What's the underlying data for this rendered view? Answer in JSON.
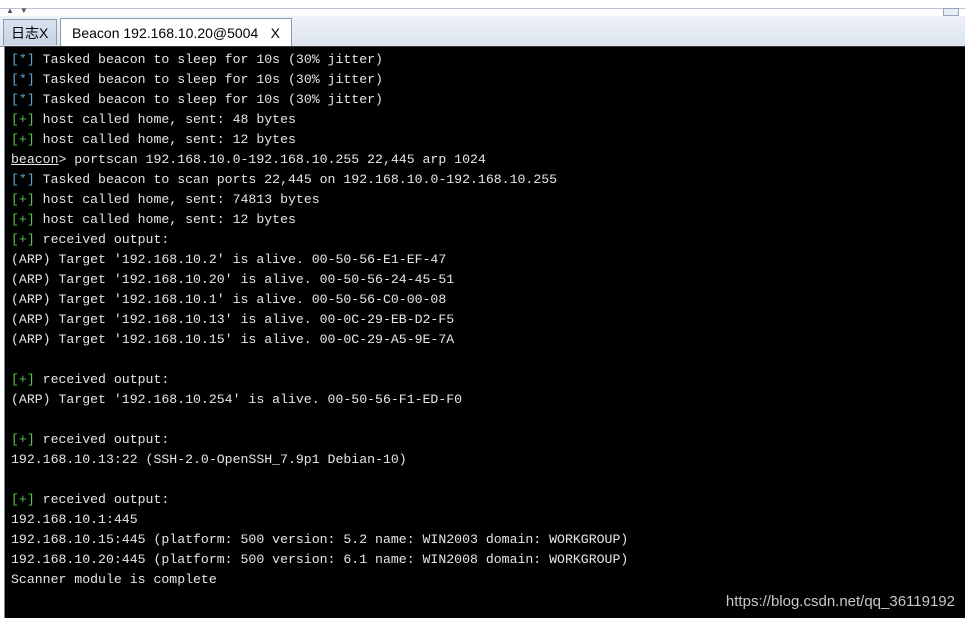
{
  "tabs": [
    {
      "label": "日志",
      "close": "X"
    },
    {
      "label": "Beacon 192.168.10.20@5004",
      "close": "X"
    }
  ],
  "console": {
    "lines": [
      {
        "tag": "[*]",
        "type": "info",
        "text": " Tasked beacon to sleep for 10s (30% jitter)"
      },
      {
        "tag": "[*]",
        "type": "info",
        "text": " Tasked beacon to sleep for 10s (30% jitter)"
      },
      {
        "tag": "[*]",
        "type": "info",
        "text": " Tasked beacon to sleep for 10s (30% jitter)"
      },
      {
        "tag": "[+]",
        "type": "good",
        "text": " host called home, sent: 48 bytes"
      },
      {
        "tag": "[+]",
        "type": "good",
        "text": " host called home, sent: 12 bytes"
      },
      {
        "prompt": "beacon",
        "type": "prompt",
        "text": "> portscan 192.168.10.0-192.168.10.255 22,445 arp 1024"
      },
      {
        "tag": "[*]",
        "type": "info",
        "text": " Tasked beacon to scan ports 22,445 on 192.168.10.0-192.168.10.255"
      },
      {
        "tag": "[+]",
        "type": "good",
        "text": " host called home, sent: 74813 bytes"
      },
      {
        "tag": "[+]",
        "type": "good",
        "text": " host called home, sent: 12 bytes"
      },
      {
        "tag": "[+]",
        "type": "good",
        "text": " received output:"
      },
      {
        "type": "plain",
        "text": "(ARP) Target '192.168.10.2' is alive. 00-50-56-E1-EF-47"
      },
      {
        "type": "plain",
        "text": "(ARP) Target '192.168.10.20' is alive. 00-50-56-24-45-51"
      },
      {
        "type": "plain",
        "text": "(ARP) Target '192.168.10.1' is alive. 00-50-56-C0-00-08"
      },
      {
        "type": "plain",
        "text": "(ARP) Target '192.168.10.13' is alive. 00-0C-29-EB-D2-F5"
      },
      {
        "type": "plain",
        "text": "(ARP) Target '192.168.10.15' is alive. 00-0C-29-A5-9E-7A"
      },
      {
        "type": "plain",
        "text": ""
      },
      {
        "tag": "[+]",
        "type": "good",
        "text": " received output:"
      },
      {
        "type": "plain",
        "text": "(ARP) Target '192.168.10.254' is alive. 00-50-56-F1-ED-F0"
      },
      {
        "type": "plain",
        "text": ""
      },
      {
        "tag": "[+]",
        "type": "good",
        "text": " received output:"
      },
      {
        "type": "plain",
        "text": "192.168.10.13:22 (SSH-2.0-OpenSSH_7.9p1 Debian-10)"
      },
      {
        "type": "plain",
        "text": ""
      },
      {
        "tag": "[+]",
        "type": "good",
        "text": " received output:"
      },
      {
        "type": "plain",
        "text": "192.168.10.1:445"
      },
      {
        "type": "plain",
        "text": "192.168.10.15:445 (platform: 500 version: 5.2 name: WIN2003 domain: WORKGROUP)"
      },
      {
        "type": "plain",
        "text": "192.168.10.20:445 (platform: 500 version: 6.1 name: WIN2008 domain: WORKGROUP)"
      },
      {
        "type": "plain",
        "text": "Scanner module is complete"
      }
    ]
  },
  "watermark": "https://blog.csdn.net/qq_36119192",
  "colors": {
    "console_bg": "#000000",
    "text": "#e6e6e6",
    "info_tag": "#5aa9d6",
    "good_tag": "#59c24a"
  }
}
